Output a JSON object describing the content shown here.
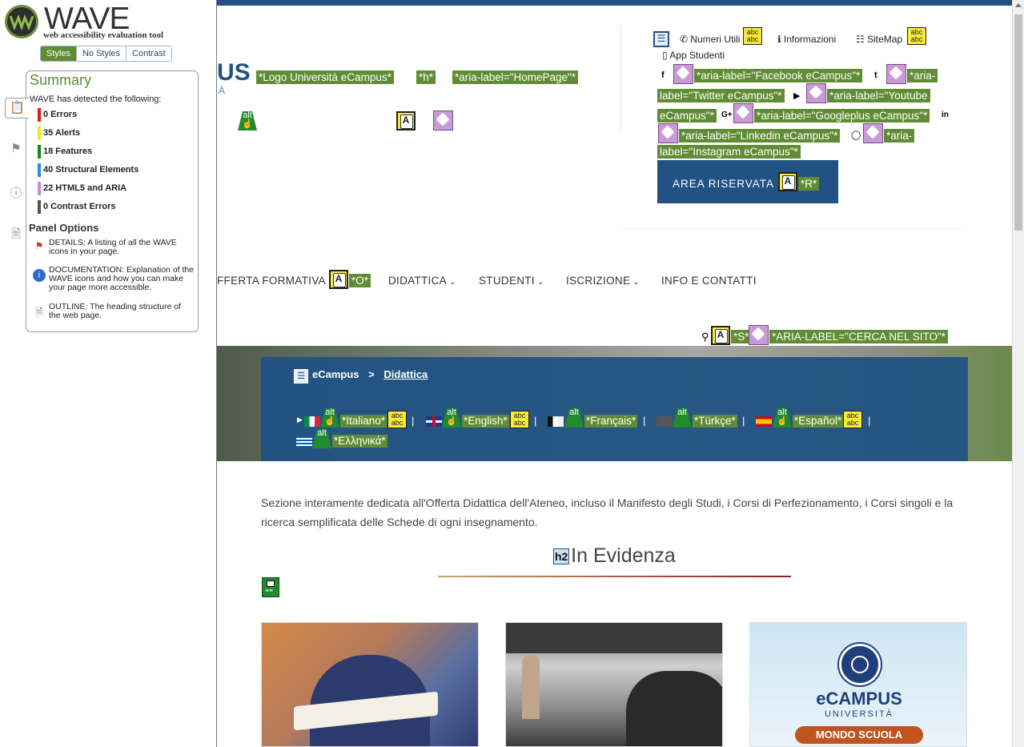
{
  "wave": {
    "title": "WAVE",
    "subtitle": "web accessibility evaluation tool",
    "tabs": [
      "Styles",
      "No Styles",
      "Contrast"
    ],
    "summary_title": "Summary",
    "detected_text": "WAVE has detected the following:",
    "rows": [
      {
        "label": "0 Errors",
        "color": "#e01b1b"
      },
      {
        "label": "35 Alerts",
        "color": "#f3e81d"
      },
      {
        "label": "18 Features",
        "color": "#178a17"
      },
      {
        "label": "40 Structural Elements",
        "color": "#2d8de6"
      },
      {
        "label": "22 HTML5 and ARIA",
        "color": "#c88ad6"
      },
      {
        "label": "0 Contrast Errors",
        "color": "#555555"
      }
    ],
    "panel_options_title": "Panel Options",
    "options": [
      {
        "text": "DETAILS: A listing of all the WAVE icons in your page.",
        "icon": "flag-icon"
      },
      {
        "text": "DOCUMENTATION: Explanation of the WAVE icons and how you can make your page more accessible.",
        "icon": "info-icon"
      },
      {
        "text": "OUTLINE: The heading structure of the web page.",
        "icon": "document-icon"
      }
    ]
  },
  "header": {
    "logo_partial": "US",
    "logo_partial2": "À",
    "logo_label": "*Logo Università eCampus*",
    "h_label": "*h*",
    "home_label": "*aria-label=\"HomePage\"*"
  },
  "utility": {
    "numeri": "Numeri Utili",
    "informazioni": "Informazioni",
    "sitemap": "SiteMap",
    "app": "App Studenti",
    "social_labels": [
      "*aria-label=\"Facebook eCampus\"*",
      "*aria-",
      "label=\"Twitter eCampus\"*",
      "*aria-label=\"Youtube",
      "eCampus\"*",
      "*aria-label=\"Googleplus eCampus\"*",
      "*aria-label=\"Linkedin eCampus\"*",
      "*aria-",
      "label=\"Instagram eCampus\"*"
    ],
    "area_riservata": "AREA RISERVATA",
    "r_label": "*R*"
  },
  "nav": {
    "items": [
      "FFERTA FORMATIVA",
      "DIDATTICA",
      "STUDENTI",
      "ISCRIZIONE",
      "INFO E CONTATTI"
    ],
    "o_label": "*O*",
    "s_label": "*S*",
    "search_label": "*ARIA-LABEL=\"CERCA NEL SITO\"*"
  },
  "breadcrumb": {
    "home": "eCampus",
    "sep": ">",
    "current": "Didattica"
  },
  "languages": [
    "*Italiano*",
    "*English*",
    "*Français*",
    "*Türkçe*",
    "*Español*",
    "*Ελληνικά*"
  ],
  "content": {
    "intro": "Sezione interamente dedicata all'Offerta Didattica dell'Ateneo, incluso il Manifesto degli Studi, i Corsi di Perfezionamento, i Corsi singoli e la ricerca semplificata delle Schede di ogni insegnamento.",
    "heading_tag": "h2",
    "heading": "In Evidenza",
    "card3_brand": "eCAMPUS",
    "card3_sub": "UNIVERSITÀ",
    "card3_tag": "MONDO SCUOLA"
  }
}
